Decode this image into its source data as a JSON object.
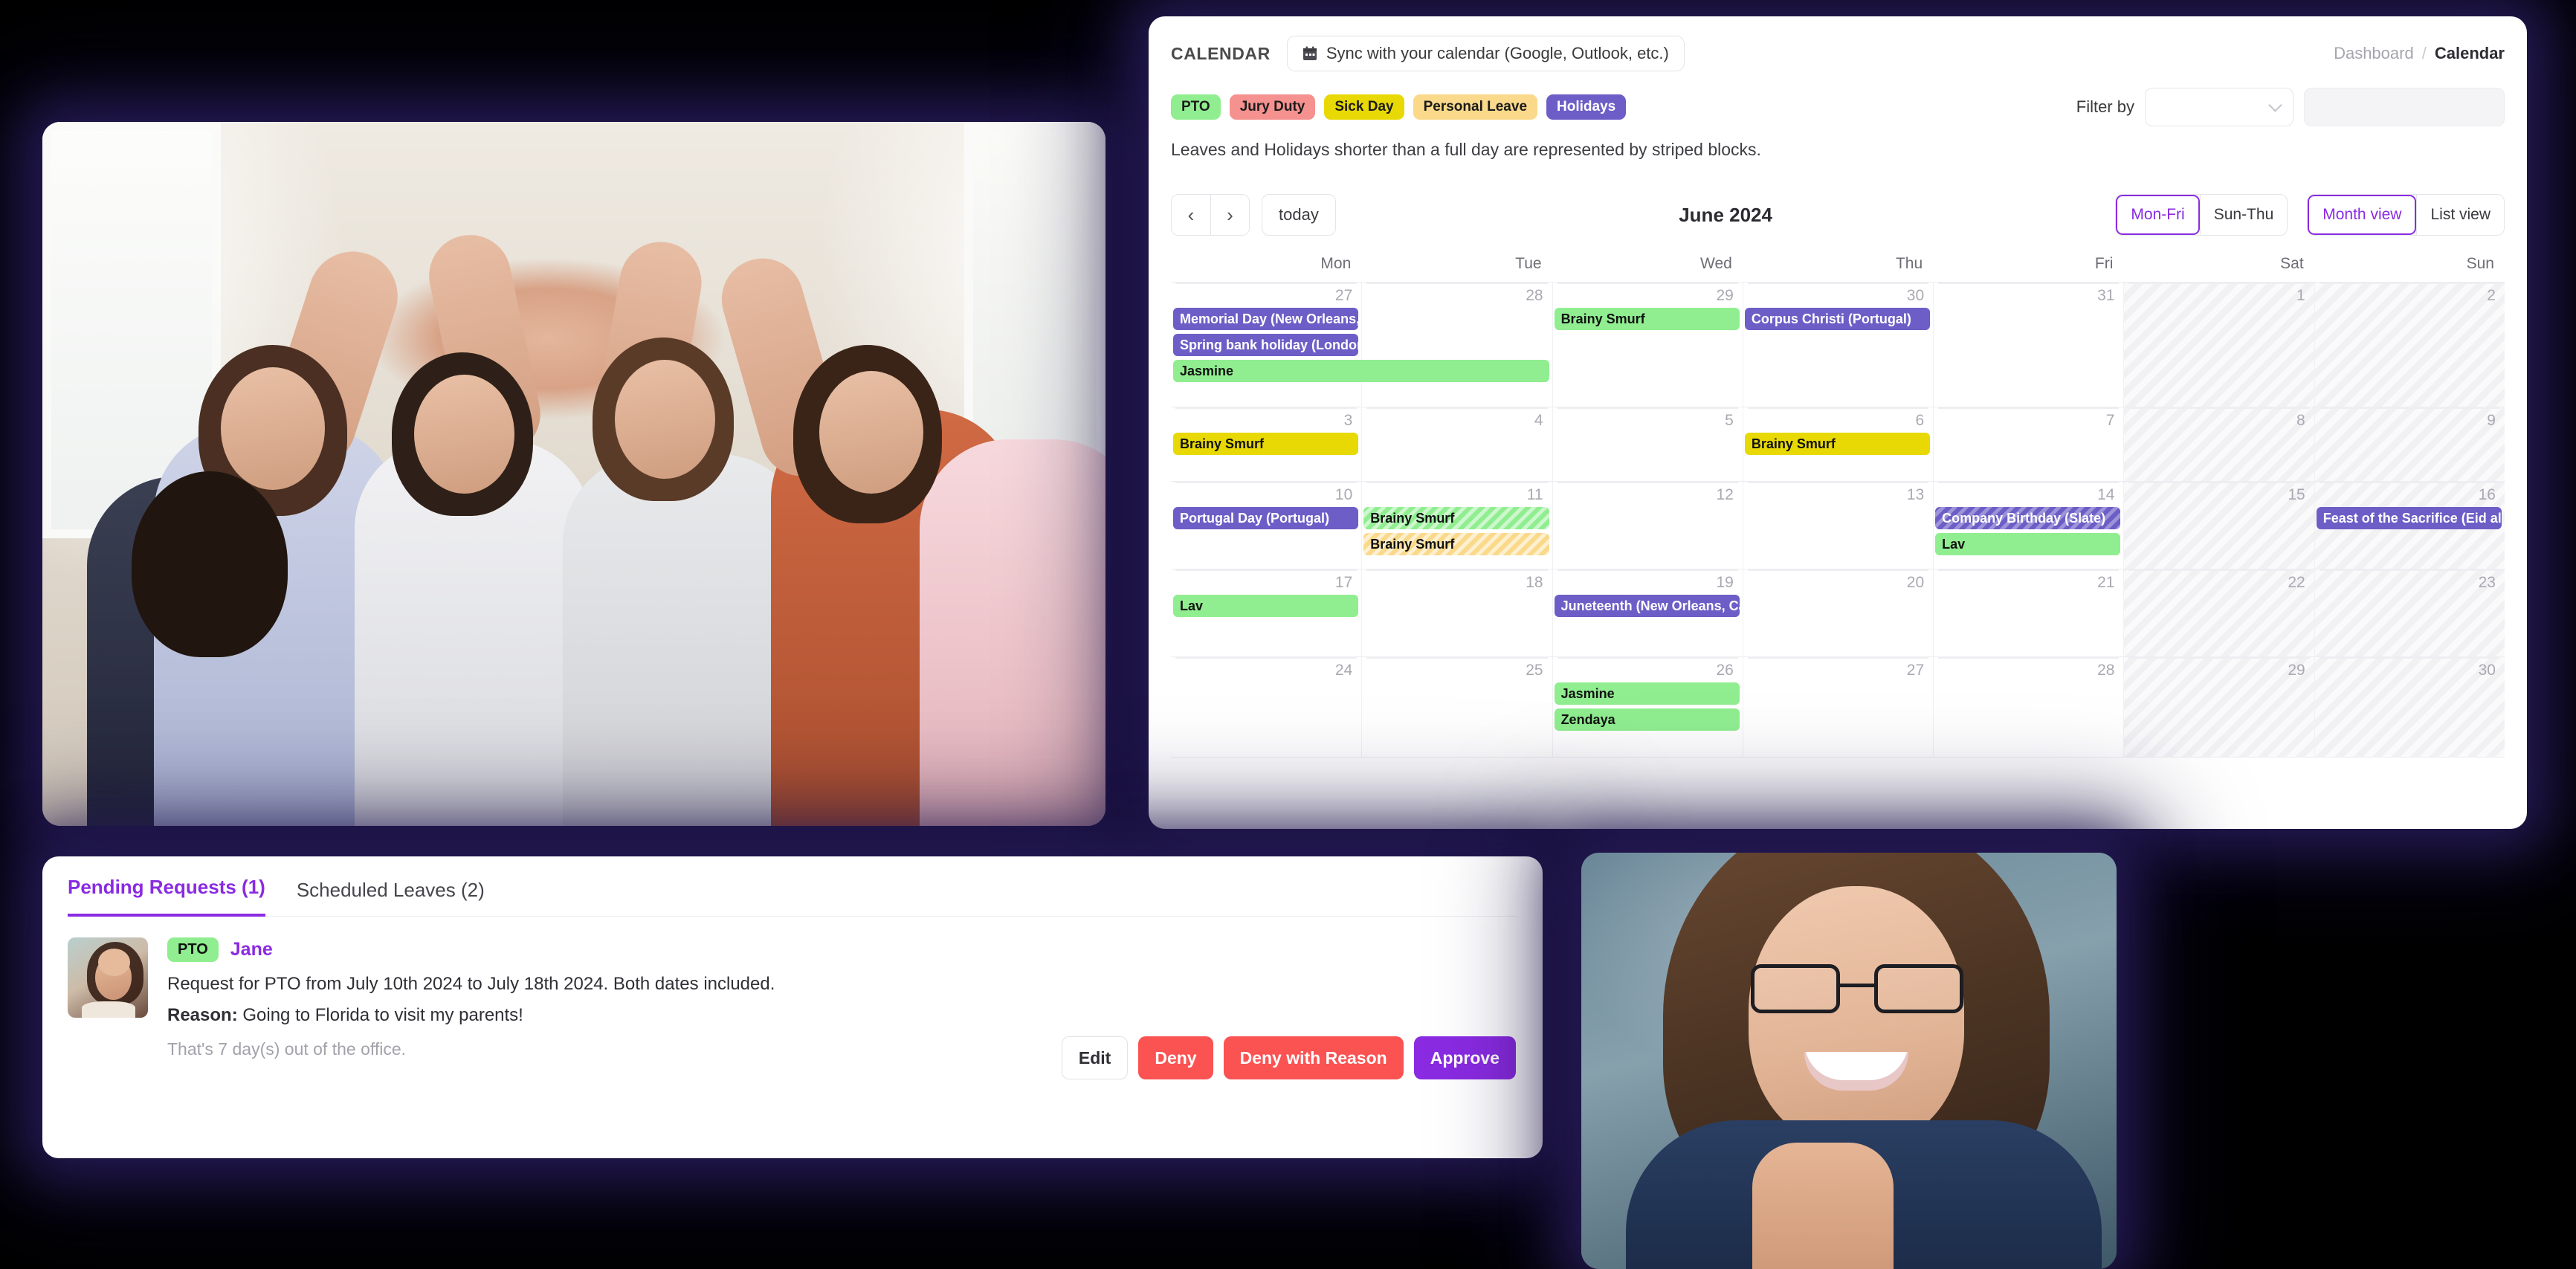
{
  "calendar": {
    "kicker": "CALENDAR",
    "sync_button": "Sync with your calendar (Google, Outlook, etc.)",
    "sync_icon": "calendar-icon",
    "breadcrumb": {
      "parent": "Dashboard",
      "separator": "/",
      "current": "Calendar"
    },
    "legend": [
      {
        "label": "PTO",
        "color": "#90ee90"
      },
      {
        "label": "Jury Duty",
        "color": "#f5918f"
      },
      {
        "label": "Sick Day",
        "color": "#e8d905"
      },
      {
        "label": "Personal Leave",
        "color": "#fad98a"
      },
      {
        "label": "Holidays",
        "color": "#6c5ec6"
      }
    ],
    "legend_note": "Leaves and Holidays shorter than a full day are represented by striped blocks.",
    "filter": {
      "label": "Filter by",
      "select_value": "",
      "input_value": ""
    },
    "toolbar": {
      "prev": "‹",
      "next": "›",
      "today": "today",
      "title": "June 2024",
      "week_views": [
        {
          "label": "Mon-Fri",
          "active": true
        },
        {
          "label": "Sun-Thu",
          "active": false
        }
      ],
      "display_views": [
        {
          "label": "Month view",
          "active": true
        },
        {
          "label": "List view",
          "active": false
        }
      ]
    },
    "day_headers": [
      "Mon",
      "Tue",
      "Wed",
      "Thu",
      "Fri",
      "Sat",
      "Sun"
    ],
    "weeks": [
      {
        "days": [
          {
            "num": "27",
            "weekend": false
          },
          {
            "num": "28",
            "weekend": false
          },
          {
            "num": "29",
            "weekend": false
          },
          {
            "num": "30",
            "weekend": false
          },
          {
            "num": "31",
            "weekend": false
          },
          {
            "num": "1",
            "weekend": true
          },
          {
            "num": "2",
            "weekend": true
          }
        ],
        "events": [
          {
            "title": "Memorial Day (New Orleans, C",
            "type": "holiday",
            "striped": false,
            "col": 0,
            "span": 1,
            "row": 0
          },
          {
            "title": "Spring bank holiday (London)",
            "type": "holiday",
            "striped": false,
            "col": 0,
            "span": 1,
            "row": 1
          },
          {
            "title": "Jasmine",
            "type": "pto",
            "striped": false,
            "col": 0,
            "span": 2,
            "row": 2
          },
          {
            "title": "Brainy Smurf",
            "type": "pto",
            "striped": false,
            "col": 2,
            "span": 1,
            "row": 0
          },
          {
            "title": "Corpus Christi (Portugal)",
            "type": "holiday",
            "striped": false,
            "col": 3,
            "span": 1,
            "row": 0
          }
        ]
      },
      {
        "days": [
          {
            "num": "3",
            "weekend": false
          },
          {
            "num": "4",
            "weekend": false
          },
          {
            "num": "5",
            "weekend": false
          },
          {
            "num": "6",
            "weekend": false
          },
          {
            "num": "7",
            "weekend": false
          },
          {
            "num": "8",
            "weekend": true
          },
          {
            "num": "9",
            "weekend": true
          }
        ],
        "events": [
          {
            "title": "Brainy Smurf",
            "type": "sick",
            "striped": false,
            "col": 0,
            "span": 1,
            "row": 0
          },
          {
            "title": "Brainy Smurf",
            "type": "sick",
            "striped": false,
            "col": 3,
            "span": 1,
            "row": 0
          }
        ]
      },
      {
        "days": [
          {
            "num": "10",
            "weekend": false
          },
          {
            "num": "11",
            "weekend": false
          },
          {
            "num": "12",
            "weekend": false
          },
          {
            "num": "13",
            "weekend": false
          },
          {
            "num": "14",
            "weekend": false
          },
          {
            "num": "15",
            "weekend": true
          },
          {
            "num": "16",
            "weekend": true
          }
        ],
        "events": [
          {
            "title": "Portugal Day (Portugal)",
            "type": "holiday",
            "striped": false,
            "col": 0,
            "span": 1,
            "row": 0
          },
          {
            "title": "Brainy Smurf",
            "type": "pto",
            "striped": true,
            "col": 1,
            "span": 1,
            "row": 0
          },
          {
            "title": "Brainy Smurf",
            "type": "personal",
            "striped": true,
            "col": 1,
            "span": 1,
            "row": 1
          },
          {
            "title": "Company Birthday (Slate)",
            "type": "holiday",
            "striped": true,
            "col": 4,
            "span": 1,
            "row": 0
          },
          {
            "title": "Lav",
            "type": "pto",
            "striped": false,
            "col": 4,
            "span": 1,
            "row": 1
          },
          {
            "title": "Feast of the Sacrifice (Eid al-A",
            "type": "holiday",
            "striped": false,
            "col": 6,
            "span": 1,
            "row": 0
          }
        ]
      },
      {
        "days": [
          {
            "num": "17",
            "weekend": false
          },
          {
            "num": "18",
            "weekend": false
          },
          {
            "num": "19",
            "weekend": false
          },
          {
            "num": "20",
            "weekend": false
          },
          {
            "num": "21",
            "weekend": false
          },
          {
            "num": "22",
            "weekend": true
          },
          {
            "num": "23",
            "weekend": true
          }
        ],
        "events": [
          {
            "title": "Lav",
            "type": "pto",
            "striped": false,
            "col": 0,
            "span": 1,
            "row": 0
          },
          {
            "title": "Juneteenth (New Orleans, Can",
            "type": "holiday",
            "striped": false,
            "col": 2,
            "span": 1,
            "row": 0
          }
        ]
      },
      {
        "days": [
          {
            "num": "24",
            "weekend": false
          },
          {
            "num": "25",
            "weekend": false
          },
          {
            "num": "26",
            "weekend": false
          },
          {
            "num": "27",
            "weekend": false
          },
          {
            "num": "28",
            "weekend": false
          },
          {
            "num": "29",
            "weekend": true
          },
          {
            "num": "30",
            "weekend": true
          }
        ],
        "events": [
          {
            "title": "Jasmine",
            "type": "pto",
            "striped": false,
            "col": 2,
            "span": 1,
            "row": 0
          },
          {
            "title": "Zendaya",
            "type": "pto",
            "striped": false,
            "col": 2,
            "span": 1,
            "row": 1
          }
        ]
      }
    ]
  },
  "requests": {
    "tabs": [
      {
        "label": "Pending Requests (1)",
        "active": true
      },
      {
        "label": "Scheduled Leaves (2)",
        "active": false
      }
    ],
    "item": {
      "tag": "PTO",
      "name": "Jane",
      "summary": "Request for PTO from July 10th 2024 to July 18th 2024. Both dates included.",
      "reason_label": "Reason:",
      "reason_text": "Going to Florida to visit my parents!",
      "days_note": "That's 7 day(s) out of the office."
    },
    "actions": [
      {
        "label": "Edit",
        "style": "edit"
      },
      {
        "label": "Deny",
        "style": "deny"
      },
      {
        "label": "Deny with Reason",
        "style": "deny-reason"
      },
      {
        "label": "Approve",
        "style": "approve"
      }
    ]
  },
  "colors": {
    "accent": "#8a2be2",
    "danger": "#fb5252",
    "pto": "#90ee90",
    "jury": "#f5918f",
    "sick": "#e8d905",
    "personal": "#fad98a",
    "holiday": "#6c5ec6",
    "page_bg": "#000000"
  }
}
